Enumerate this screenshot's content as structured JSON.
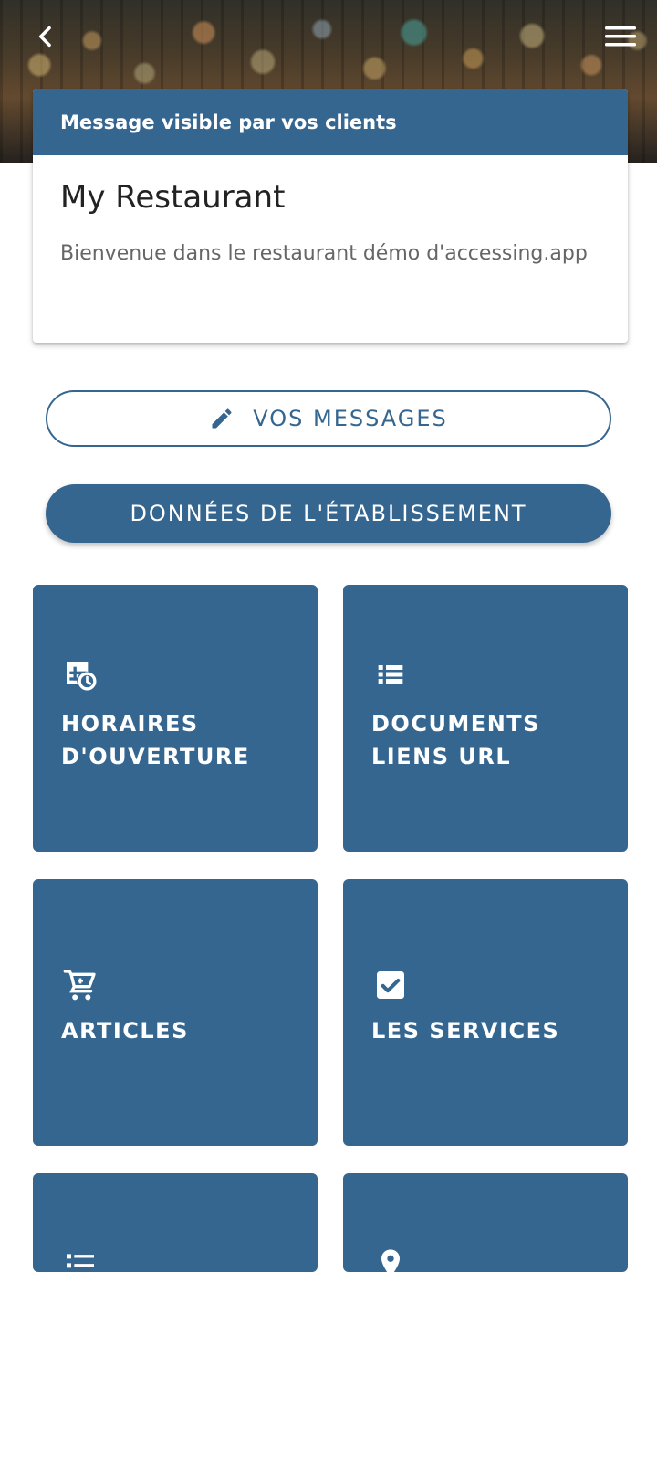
{
  "header": {
    "back_icon": "chevron-left-icon",
    "menu_icon": "hamburger-menu-icon"
  },
  "message_card": {
    "header": "Message visible par vos clients",
    "title": "My Restaurant",
    "text": "Bienvenue dans le restaurant démo d'accessing.app"
  },
  "buttons": {
    "messages_label": "VOS MESSAGES",
    "messages_icon": "pencil-icon",
    "establishment_label": "DONNÉES DE L'ÉTABLISSEMENT"
  },
  "tiles": [
    {
      "label": "HORAIRES\nD'OUVERTURE",
      "icon": "calendar-clock-icon"
    },
    {
      "label": "DOCUMENTS\nLIENS URL",
      "icon": "list-view-icon"
    },
    {
      "label": "ARTICLES",
      "icon": "cart-icon"
    },
    {
      "label": "LES SERVICES",
      "icon": "checkbox-icon"
    },
    {
      "label": "",
      "icon": "bulleted-list-icon"
    },
    {
      "label": "",
      "icon": "location-icon"
    }
  ],
  "colors": {
    "primary": "#356690",
    "background": "#ffffff",
    "text_dark": "#222222",
    "text_muted": "#666666"
  }
}
